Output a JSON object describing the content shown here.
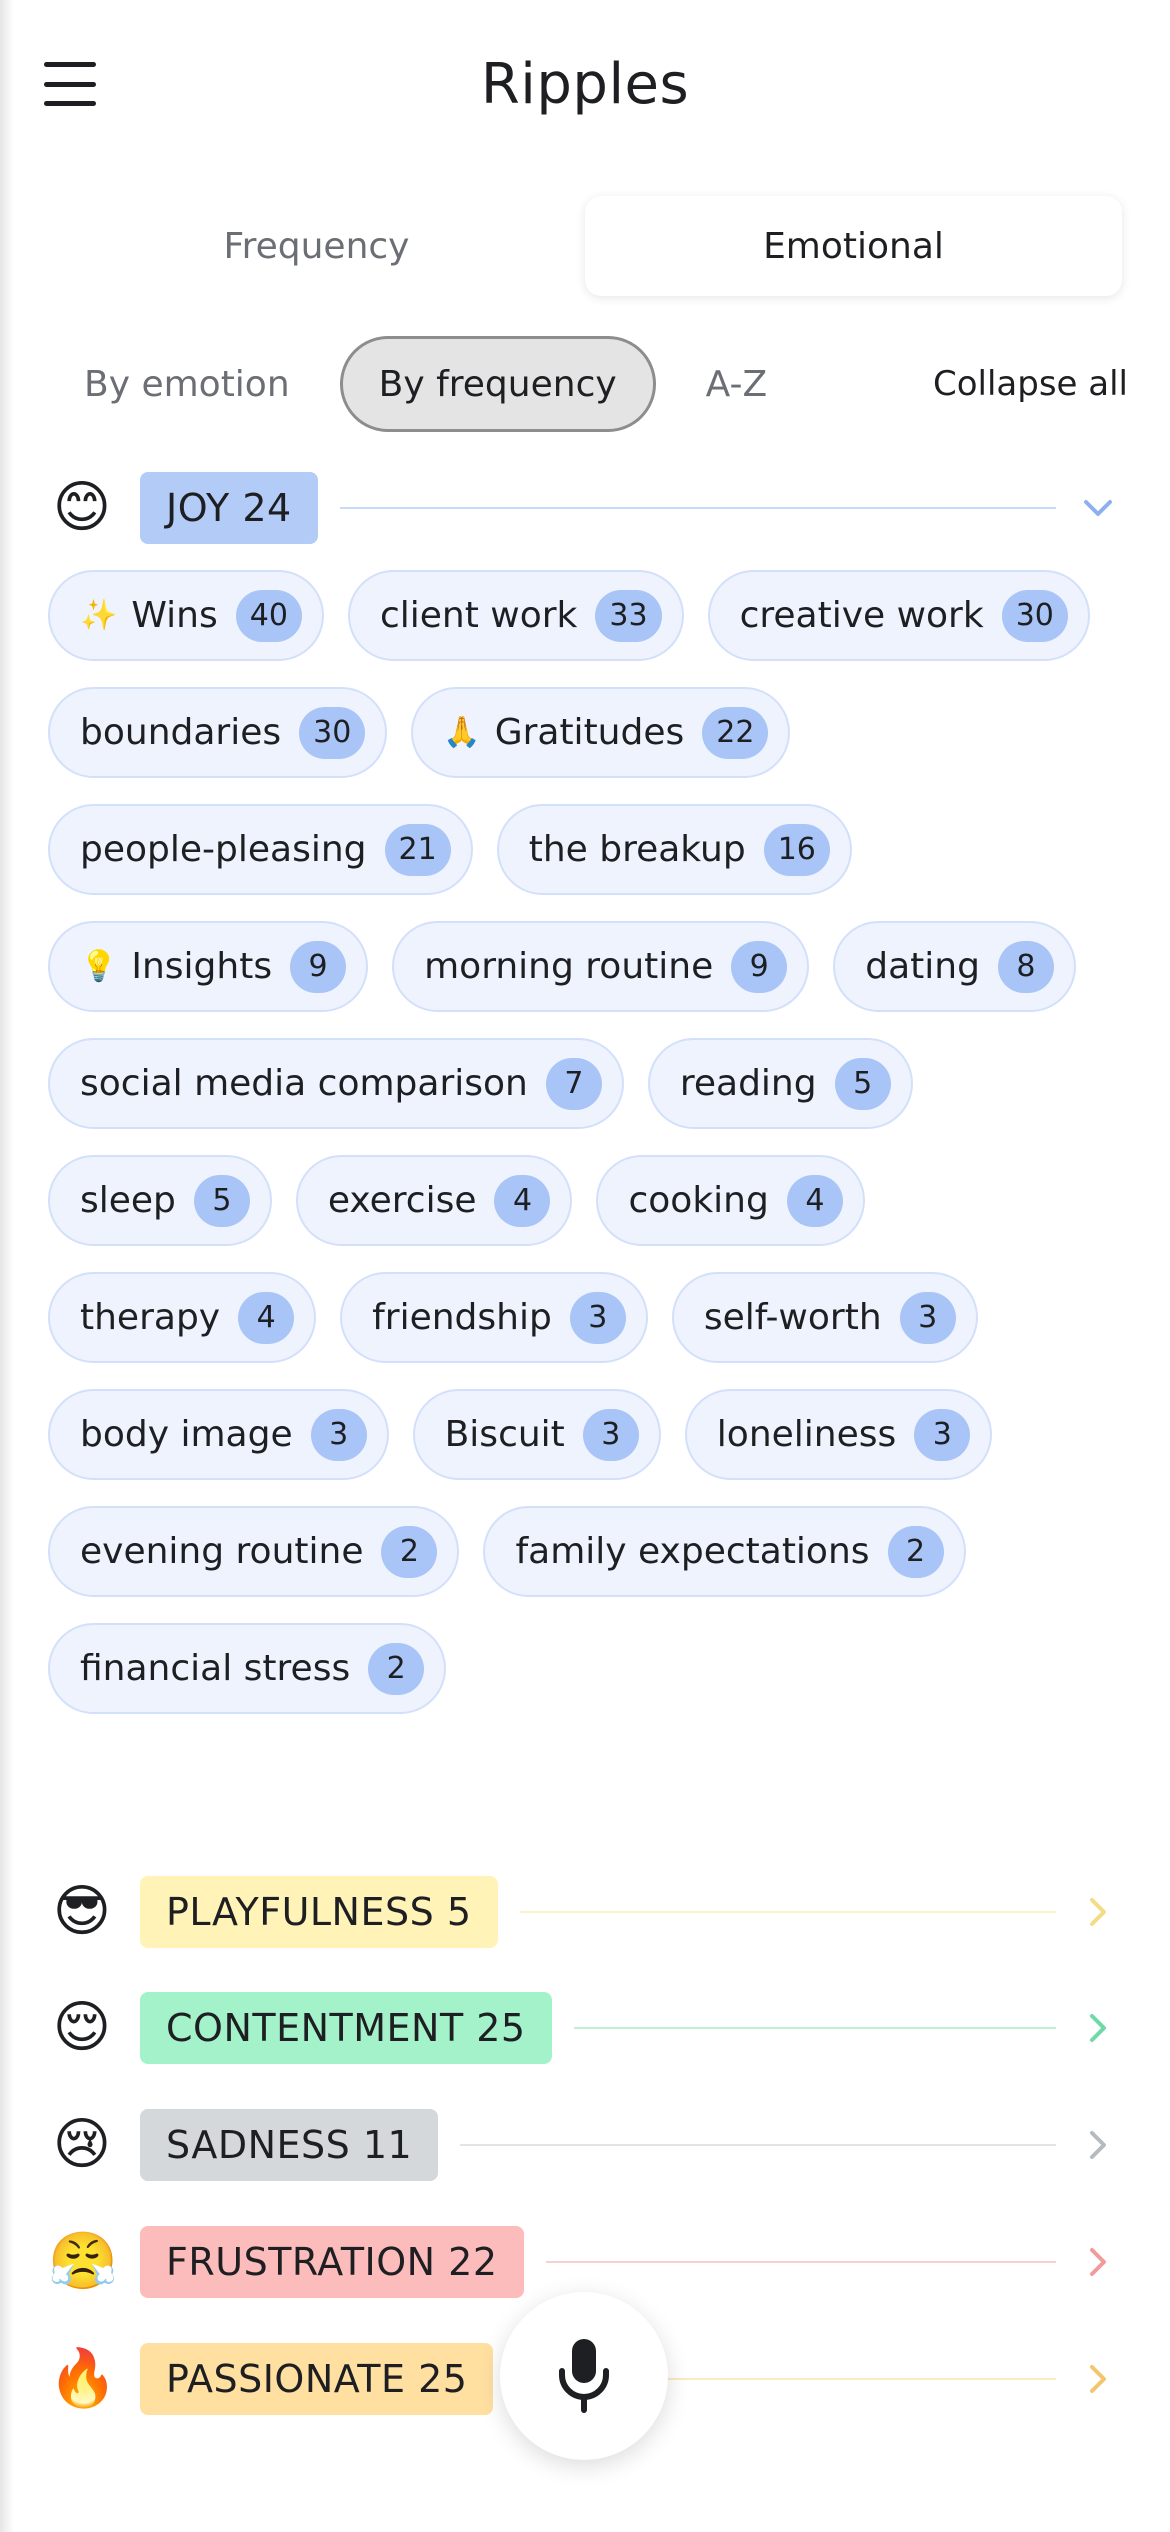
{
  "app": {
    "title": "Ripples"
  },
  "tabs": [
    {
      "label": "Frequency",
      "active": false
    },
    {
      "label": "Emotional",
      "active": true
    }
  ],
  "sort": {
    "options": [
      "By emotion",
      "By frequency",
      "A-Z"
    ],
    "active": "By frequency",
    "collapse_label": "Collapse all"
  },
  "categories": [
    {
      "emoji": "😊",
      "label": "JOY 24",
      "color": "#b3ccf7",
      "line": "#c8daf9",
      "chev": "#8fb0ef",
      "expanded": true
    },
    {
      "emoji": "😎",
      "label": "PLAYFULNESS 5",
      "color": "#fff3b8",
      "line": "#fbf1c6",
      "chev": "#f3dc86",
      "expanded": false
    },
    {
      "emoji": "😌",
      "label": "CONTENTMENT 25",
      "color": "#a3f2c9",
      "line": "#bff0d6",
      "chev": "#6fd9a7",
      "expanded": false
    },
    {
      "emoji": "😢",
      "label": "SADNESS 11",
      "color": "#d4d8db",
      "line": "#e2e5e7",
      "chev": "#b5bbbf",
      "expanded": false
    },
    {
      "emoji": "😤",
      "label": "FRUSTRATION 22",
      "color": "#fdbcbc",
      "line": "#f9cfcf",
      "chev": "#f19b9b",
      "expanded": false
    },
    {
      "emoji": "🔥",
      "label": "PASSIONATE 25",
      "color": "#ffe0a1",
      "line": "#fde9c2",
      "chev": "#f3c66d",
      "expanded": false
    }
  ],
  "joy_topics": [
    {
      "emoji": "✨",
      "label": "Wins",
      "count": "40"
    },
    {
      "label": "client work",
      "count": "33"
    },
    {
      "label": "creative work",
      "count": "30"
    },
    {
      "label": "boundaries",
      "count": "30"
    },
    {
      "emoji": "🙏",
      "label": "Gratitudes",
      "count": "22"
    },
    {
      "label": "people-pleasing",
      "count": "21"
    },
    {
      "label": "the breakup",
      "count": "16"
    },
    {
      "emoji": "💡",
      "label": "Insights",
      "count": "9"
    },
    {
      "label": "morning routine",
      "count": "9"
    },
    {
      "label": "dating",
      "count": "8"
    },
    {
      "label": "social media comparison",
      "count": "7"
    },
    {
      "label": "reading",
      "count": "5"
    },
    {
      "label": "sleep",
      "count": "5"
    },
    {
      "label": "exercise",
      "count": "4"
    },
    {
      "label": "cooking",
      "count": "4"
    },
    {
      "label": "therapy",
      "count": "4"
    },
    {
      "label": "friendship",
      "count": "3"
    },
    {
      "label": "self-worth",
      "count": "3"
    },
    {
      "label": "body image",
      "count": "3"
    },
    {
      "label": "Biscuit",
      "count": "3"
    },
    {
      "label": "loneliness",
      "count": "3"
    },
    {
      "label": "evening routine",
      "count": "2"
    },
    {
      "label": "family expectations",
      "count": "2"
    },
    {
      "label": "financial stress",
      "count": "2"
    }
  ],
  "icons": {
    "menu": "hamburger-icon",
    "mic": "microphone-icon",
    "expand": "chevron-down-icon",
    "collapsed": "chevron-right-icon"
  }
}
